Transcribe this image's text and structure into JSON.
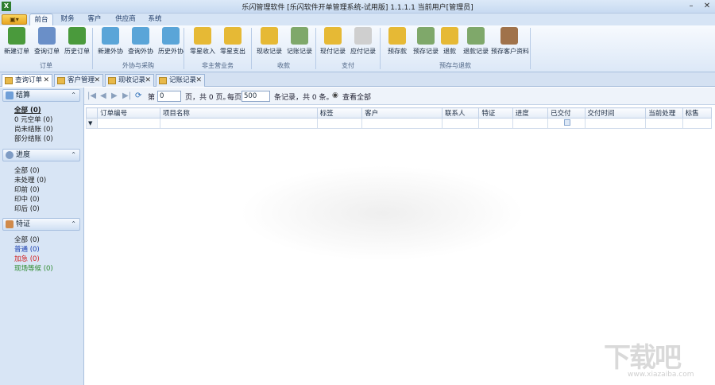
{
  "titlebar": {
    "title": "乐闪管理软件 [乐闪软件开单管理系统-试用版] 1.1.1.1  当前用户[管理员]",
    "app_icon": "X",
    "min": "–",
    "close": "✕"
  },
  "menu_tabs": {
    "app_menu": "▣▾",
    "tabs": [
      "前台",
      "财务",
      "客户",
      "供应商",
      "系统"
    ]
  },
  "ribbon": {
    "buttons": [
      {
        "label": "新建订单",
        "icon": "new-order-icon",
        "color": "#4a9a3c"
      },
      {
        "label": "查询订单",
        "icon": "query-order-icon",
        "color": "#6a8fc8"
      },
      {
        "label": "历史订单",
        "icon": "history-order-icon",
        "color": "#4a9a3c"
      },
      {
        "label": "新建外协",
        "icon": "new-outsource-icon",
        "color": "#5aa5d8"
      },
      {
        "label": "查询外协",
        "icon": "query-outsource-icon",
        "color": "#5aa5d8"
      },
      {
        "label": "历史外协",
        "icon": "history-outsource-icon",
        "color": "#5aa5d8"
      },
      {
        "label": "零星收入",
        "icon": "income-icon",
        "color": "#e6b935"
      },
      {
        "label": "零星支出",
        "icon": "expense-icon",
        "color": "#e6b935"
      },
      {
        "label": "现收记录",
        "icon": "cash-record-icon",
        "color": "#e6b935"
      },
      {
        "label": "记账记录",
        "icon": "ledger-record-icon",
        "color": "#7fa86a"
      },
      {
        "label": "现付记录",
        "icon": "cash-pay-icon",
        "color": "#e6b935"
      },
      {
        "label": "应付记录",
        "icon": "payable-icon",
        "color": "#cfcfcf"
      },
      {
        "label": "预存款",
        "icon": "deposit-icon",
        "color": "#e6b935"
      },
      {
        "label": "预存记录",
        "icon": "deposit-record-icon",
        "color": "#7fa86a"
      },
      {
        "label": "退款",
        "icon": "refund-icon",
        "color": "#e6b935"
      },
      {
        "label": "退款记录",
        "icon": "refund-record-icon",
        "color": "#7fa86a"
      },
      {
        "label": "预存客户资料",
        "icon": "customer-profile-icon",
        "color": "#a0724a"
      }
    ],
    "groups": [
      "订单",
      "外协与采购",
      "非主营业务",
      "收款",
      "支付",
      "预存与退款"
    ]
  },
  "doc_tabs": [
    {
      "label": "查询订单",
      "active": true
    },
    {
      "label": "客户管理",
      "active": false
    },
    {
      "label": "现收记录",
      "active": false
    },
    {
      "label": "记账记录",
      "active": false
    }
  ],
  "sidebar": {
    "panels": [
      {
        "title": "结算",
        "items": [
          {
            "label": "全部 (0)",
            "color": "#1a3fb0"
          },
          {
            "label": "0 元空单 (0)",
            "color": "#111"
          },
          {
            "label": "尚未结账 (0)",
            "color": "#111"
          },
          {
            "label": "部分结账 (0)",
            "color": "#111"
          }
        ]
      },
      {
        "title": "进度",
        "items": [
          {
            "label": "全部 (0)",
            "color": "#111"
          },
          {
            "label": "未处理 (0)",
            "color": "#111"
          },
          {
            "label": "印前 (0)",
            "color": "#111"
          },
          {
            "label": "印中 (0)",
            "color": "#111"
          },
          {
            "label": "印后 (0)",
            "color": "#111"
          }
        ]
      },
      {
        "title": "特证",
        "items": [
          {
            "label": "全部 (0)",
            "color": "#111"
          },
          {
            "label": "普通 (0)",
            "color": "#1a3fb0"
          },
          {
            "label": "加急 (0)",
            "color": "#d21f1f"
          },
          {
            "label": "现场等候 (0)",
            "color": "#2d8a2d"
          }
        ]
      }
    ]
  },
  "pager": {
    "page_prefix": "第",
    "page_value": "0",
    "page_suffix": "页，共 0 页。",
    "per_page_prefix": "每页",
    "per_page_value": "500",
    "per_page_suffix": "条记录，共 0 条。",
    "view_all": "查看全部"
  },
  "grid": {
    "columns": [
      "订单编号",
      "项目名称",
      "标签",
      "客户",
      "联系人",
      "特证",
      "进度",
      "已交付",
      "交付时间",
      "当前处理",
      "标售"
    ],
    "filter_marker": "▼"
  },
  "watermark": {
    "logo": "下载吧",
    "url": "www.xiazaiba.com"
  }
}
